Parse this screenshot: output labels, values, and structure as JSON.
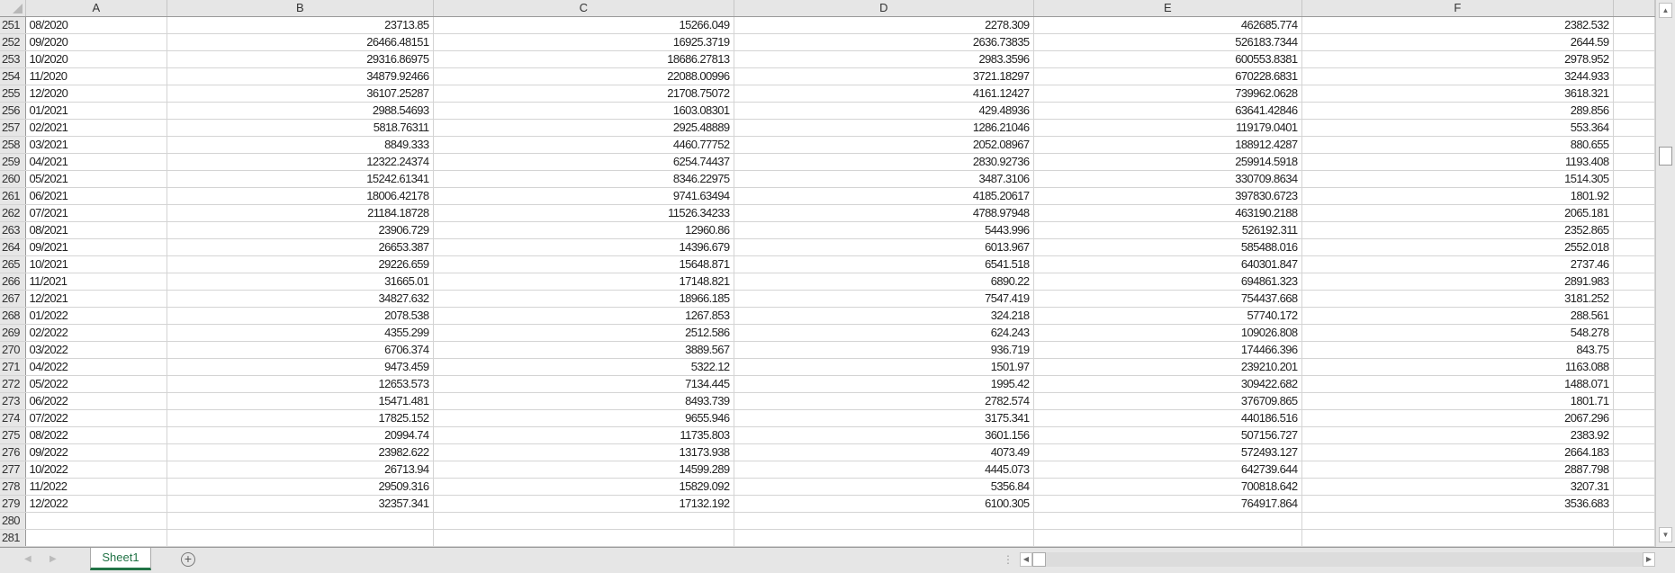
{
  "columns": [
    "A",
    "B",
    "C",
    "D",
    "E",
    "F"
  ],
  "rows": [
    {
      "n": "251",
      "a": "08/2020",
      "b": "23713.85",
      "c": "15266.049",
      "d": "2278.309",
      "e": "462685.774",
      "f": "2382.532"
    },
    {
      "n": "252",
      "a": "09/2020",
      "b": "26466.48151",
      "c": "16925.3719",
      "d": "2636.73835",
      "e": "526183.7344",
      "f": "2644.59"
    },
    {
      "n": "253",
      "a": "10/2020",
      "b": "29316.86975",
      "c": "18686.27813",
      "d": "2983.3596",
      "e": "600553.8381",
      "f": "2978.952"
    },
    {
      "n": "254",
      "a": "11/2020",
      "b": "34879.92466",
      "c": "22088.00996",
      "d": "3721.18297",
      "e": "670228.6831",
      "f": "3244.933"
    },
    {
      "n": "255",
      "a": "12/2020",
      "b": "36107.25287",
      "c": "21708.75072",
      "d": "4161.12427",
      "e": "739962.0628",
      "f": "3618.321"
    },
    {
      "n": "256",
      "a": "01/2021",
      "b": "2988.54693",
      "c": "1603.08301",
      "d": "429.48936",
      "e": "63641.42846",
      "f": "289.856"
    },
    {
      "n": "257",
      "a": "02/2021",
      "b": "5818.76311",
      "c": "2925.48889",
      "d": "1286.21046",
      "e": "119179.0401",
      "f": "553.364"
    },
    {
      "n": "258",
      "a": "03/2021",
      "b": "8849.333",
      "c": "4460.77752",
      "d": "2052.08967",
      "e": "188912.4287",
      "f": "880.655"
    },
    {
      "n": "259",
      "a": "04/2021",
      "b": "12322.24374",
      "c": "6254.74437",
      "d": "2830.92736",
      "e": "259914.5918",
      "f": "1193.408"
    },
    {
      "n": "260",
      "a": "05/2021",
      "b": "15242.61341",
      "c": "8346.22975",
      "d": "3487.3106",
      "e": "330709.8634",
      "f": "1514.305"
    },
    {
      "n": "261",
      "a": "06/2021",
      "b": "18006.42178",
      "c": "9741.63494",
      "d": "4185.20617",
      "e": "397830.6723",
      "f": "1801.92"
    },
    {
      "n": "262",
      "a": "07/2021",
      "b": "21184.18728",
      "c": "11526.34233",
      "d": "4788.97948",
      "e": "463190.2188",
      "f": "2065.181"
    },
    {
      "n": "263",
      "a": "08/2021",
      "b": "23906.729",
      "c": "12960.86",
      "d": "5443.996",
      "e": "526192.311",
      "f": "2352.865"
    },
    {
      "n": "264",
      "a": "09/2021",
      "b": "26653.387",
      "c": "14396.679",
      "d": "6013.967",
      "e": "585488.016",
      "f": "2552.018"
    },
    {
      "n": "265",
      "a": "10/2021",
      "b": "29226.659",
      "c": "15648.871",
      "d": "6541.518",
      "e": "640301.847",
      "f": "2737.46"
    },
    {
      "n": "266",
      "a": "11/2021",
      "b": "31665.01",
      "c": "17148.821",
      "d": "6890.22",
      "e": "694861.323",
      "f": "2891.983"
    },
    {
      "n": "267",
      "a": "12/2021",
      "b": "34827.632",
      "c": "18966.185",
      "d": "7547.419",
      "e": "754437.668",
      "f": "3181.252"
    },
    {
      "n": "268",
      "a": "01/2022",
      "b": "2078.538",
      "c": "1267.853",
      "d": "324.218",
      "e": "57740.172",
      "f": "288.561"
    },
    {
      "n": "269",
      "a": "02/2022",
      "b": "4355.299",
      "c": "2512.586",
      "d": "624.243",
      "e": "109026.808",
      "f": "548.278"
    },
    {
      "n": "270",
      "a": "03/2022",
      "b": "6706.374",
      "c": "3889.567",
      "d": "936.719",
      "e": "174466.396",
      "f": "843.75"
    },
    {
      "n": "271",
      "a": "04/2022",
      "b": "9473.459",
      "c": "5322.12",
      "d": "1501.97",
      "e": "239210.201",
      "f": "1163.088"
    },
    {
      "n": "272",
      "a": "05/2022",
      "b": "12653.573",
      "c": "7134.445",
      "d": "1995.42",
      "e": "309422.682",
      "f": "1488.071"
    },
    {
      "n": "273",
      "a": "06/2022",
      "b": "15471.481",
      "c": "8493.739",
      "d": "2782.574",
      "e": "376709.865",
      "f": "1801.71"
    },
    {
      "n": "274",
      "a": "07/2022",
      "b": "17825.152",
      "c": "9655.946",
      "d": "3175.341",
      "e": "440186.516",
      "f": "2067.296"
    },
    {
      "n": "275",
      "a": "08/2022",
      "b": "20994.74",
      "c": "11735.803",
      "d": "3601.156",
      "e": "507156.727",
      "f": "2383.92"
    },
    {
      "n": "276",
      "a": "09/2022",
      "b": "23982.622",
      "c": "13173.938",
      "d": "4073.49",
      "e": "572493.127",
      "f": "2664.183"
    },
    {
      "n": "277",
      "a": "10/2022",
      "b": "26713.94",
      "c": "14599.289",
      "d": "4445.073",
      "e": "642739.644",
      "f": "2887.798"
    },
    {
      "n": "278",
      "a": "11/2022",
      "b": "29509.316",
      "c": "15829.092",
      "d": "5356.84",
      "e": "700818.642",
      "f": "3207.31"
    },
    {
      "n": "279",
      "a": "12/2022",
      "b": "32357.341",
      "c": "17132.192",
      "d": "6100.305",
      "e": "764917.864",
      "f": "3536.683"
    },
    {
      "n": "280",
      "a": "",
      "b": "",
      "c": "",
      "d": "",
      "e": "",
      "f": ""
    },
    {
      "n": "281",
      "a": "",
      "b": "",
      "c": "",
      "d": "",
      "e": "",
      "f": ""
    }
  ],
  "sheet_tabs": [
    "Sheet1"
  ],
  "icons": {
    "add_sheet": "plus-circle-icon",
    "scroll_up": "triangle-up-icon",
    "scroll_down": "triangle-down-icon"
  },
  "colors": {
    "accent": "#217346",
    "header_bg": "#e6e6e6",
    "gridline": "#d4d4d4"
  }
}
